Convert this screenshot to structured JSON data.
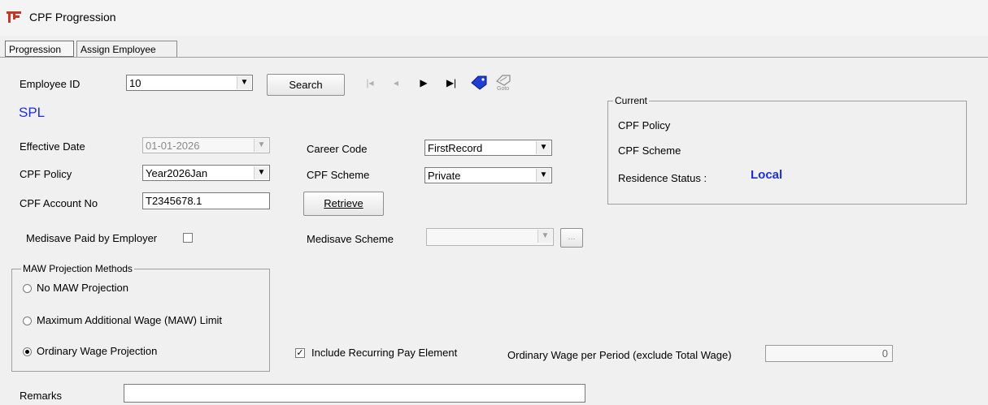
{
  "window": {
    "title": "CPF Progression"
  },
  "tabs": [
    {
      "label": "Progression"
    },
    {
      "label": "Assign Employee"
    }
  ],
  "employee": {
    "id_label": "Employee ID",
    "id_value": "10",
    "search_label": "Search",
    "code": "SPL"
  },
  "nav": {
    "first": "|◂",
    "prev": "◂",
    "next": "▶",
    "last": "▶|",
    "goto_label": "Goto"
  },
  "form": {
    "effective_date_label": "Effective Date",
    "effective_date_value": "01-01-2026",
    "cpf_policy_label": "CPF Policy",
    "cpf_policy_value": "Year2026Jan",
    "cpf_account_label": "CPF Account No",
    "cpf_account_value": "T2345678.1",
    "medisave_employer_label": "Medisave Paid by Employer",
    "career_code_label": "Career Code",
    "career_code_value": "FirstRecord",
    "cpf_scheme_label": "CPF Scheme",
    "cpf_scheme_value": "Private",
    "retrieve_label": "Retrieve",
    "medisave_scheme_label": "Medisave Scheme",
    "medisave_scheme_value": "",
    "ellipsis_label": "..."
  },
  "current": {
    "title": "Current",
    "cpf_policy_label": "CPF Policy",
    "cpf_scheme_label": "CPF Scheme",
    "residence_label": "Residence Status :",
    "residence_value": "Local",
    "residence_color": "#1f2fd8"
  },
  "maw": {
    "title": "MAW Projection Methods",
    "options": [
      {
        "label": "No MAW Projection",
        "selected": false
      },
      {
        "label": "Maximum Additional Wage (MAW) Limit",
        "selected": false
      },
      {
        "label": "Ordinary Wage Projection",
        "selected": true
      }
    ]
  },
  "recurring": {
    "label": "Include Recurring Pay Element",
    "checked": true
  },
  "ordinary_wage": {
    "label": "Ordinary Wage per Period (exclude Total Wage)",
    "value": "0"
  },
  "remarks": {
    "label": "Remarks",
    "value": ""
  },
  "colors": {
    "accent_blue": "#1f2fd8"
  }
}
